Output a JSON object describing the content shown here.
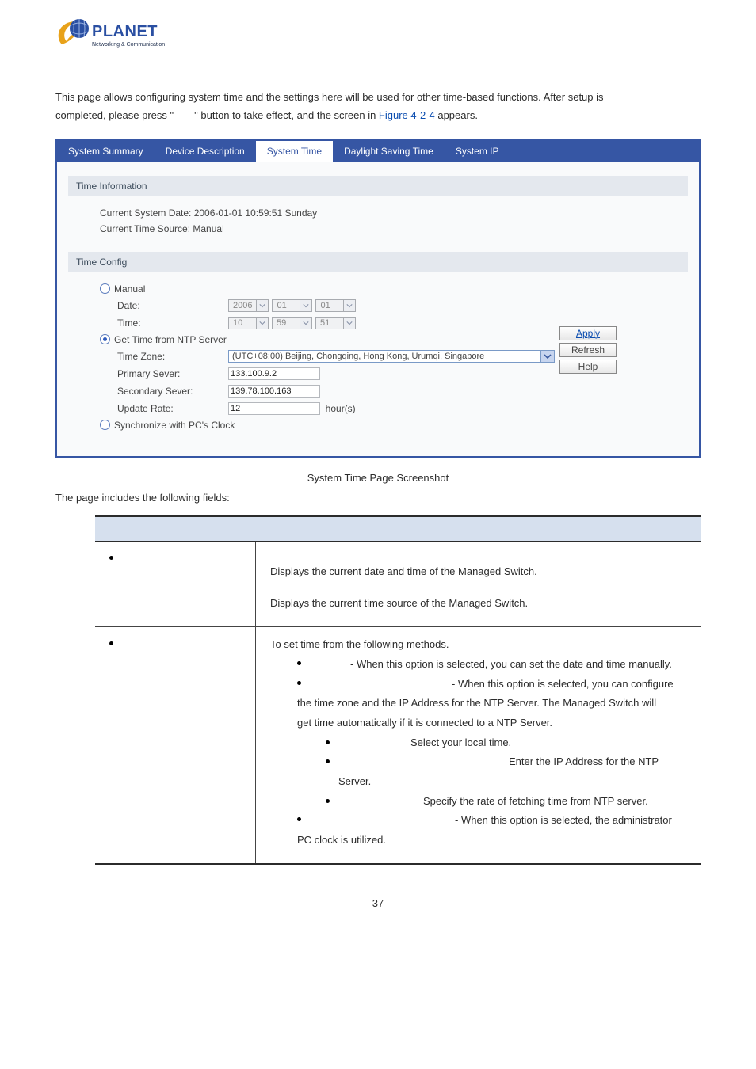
{
  "logo": {
    "brand": "PLANET",
    "tagline": "Networking & Communication"
  },
  "intro": {
    "line1": "This page allows configuring system time and the settings here will be used for other time-based functions. After setup is",
    "line2a": "completed, please press \"",
    "line2b": "\" button to take effect, and the screen in ",
    "figure_ref": "Figure 4-2-4",
    "line2c": " appears."
  },
  "tabs": [
    "System Summary",
    "Device Description",
    "System Time",
    "Daylight Saving Time",
    "System IP"
  ],
  "active_tab_index": 2,
  "time_info": {
    "header": "Time Information",
    "line1": "Current System Date: 2006-01-01   10:59:51    Sunday",
    "line2": "Current Time Source:   Manual"
  },
  "time_config": {
    "header": "Time Config",
    "manual": "Manual",
    "date_label": "Date:",
    "date_y": "2006",
    "date_m": "01",
    "date_d": "01",
    "time_label": "Time:",
    "time_h": "10",
    "time_m": "59",
    "time_s": "51",
    "ntp_label": "Get Time from NTP Server",
    "tz_label": "Time Zone:",
    "tz_value": "(UTC+08:00) Beijing, Chongqing, Hong Kong, Urumqi, Singapore",
    "primary_label": "Primary Sever:",
    "primary_value": "133.100.9.2",
    "secondary_label": "Secondary Sever:",
    "secondary_value": "139.78.100.163",
    "rate_label": "Update Rate:",
    "rate_value": "12",
    "rate_unit": "hour(s)",
    "pc_sync": "Synchronize with PC's Clock"
  },
  "buttons": {
    "apply": "Apply",
    "refresh": "Refresh",
    "help": "Help"
  },
  "caption": "System Time Page Screenshot",
  "fields_intro": "The page includes the following fields:",
  "table": {
    "row1": {
      "d1": "Displays the current date and time of the Managed Switch.",
      "d2": "Displays the current time source of the Managed Switch."
    },
    "row2": {
      "l1": "To set time from the following methods.",
      "b1": "- When this option is selected, you can set the date and time manually.",
      "b2a": "- When this option is selected, you can configure",
      "b2b": "the time zone and the IP Address for the NTP Server. The Managed Switch will",
      "b2c": "get time automatically if it is connected to a NTP Server.",
      "s1": "Select your local time.",
      "s2a": "Enter the IP Address for the NTP",
      "s2b": "Server.",
      "s3": "Specify the rate of fetching time from NTP server.",
      "b3a": "- When this option is selected, the administrator",
      "b3b": "PC clock is utilized."
    }
  },
  "page_number": "37"
}
